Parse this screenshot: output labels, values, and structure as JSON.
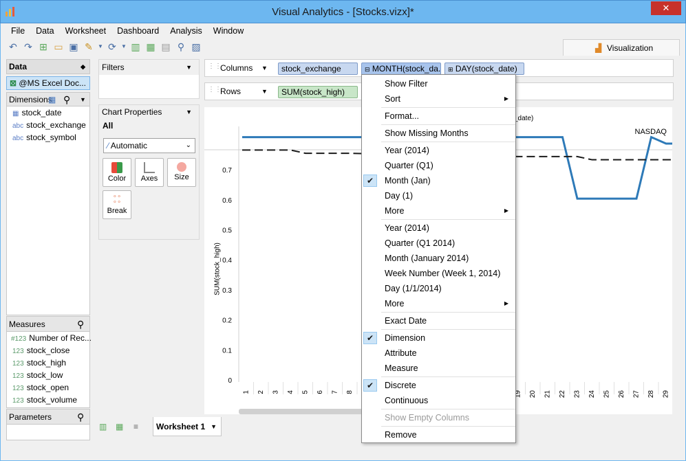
{
  "window": {
    "title": "Visual Analytics - [Stocks.vizx]*",
    "close": "✕"
  },
  "menu": [
    "File",
    "Data",
    "Worksheet",
    "Dashboard",
    "Analysis",
    "Window"
  ],
  "vis_tab": "Visualization",
  "data_panel": {
    "header": "Data",
    "source": "@MS Excel Doc...",
    "dimensions_header": "Dimensions",
    "dimensions": [
      {
        "type": "date",
        "name": "stock_date"
      },
      {
        "type": "abc",
        "name": "stock_exchange"
      },
      {
        "type": "abc",
        "name": "stock_symbol"
      }
    ],
    "measures_header": "Measures",
    "measures": [
      {
        "type": "#123",
        "name": "Number of Rec..."
      },
      {
        "type": "123",
        "name": "stock_close"
      },
      {
        "type": "123",
        "name": "stock_high"
      },
      {
        "type": "123",
        "name": "stock_low"
      },
      {
        "type": "123",
        "name": "stock_open"
      },
      {
        "type": "123",
        "name": "stock_volume"
      }
    ],
    "parameters_header": "Parameters"
  },
  "filters": {
    "header": "Filters"
  },
  "chart_properties": {
    "header": "Chart Properties",
    "all": "All",
    "mark_type": "Automatic",
    "buttons": [
      "Color",
      "Axes",
      "Size",
      "Break"
    ]
  },
  "shelves": {
    "columns_label": "Columns",
    "rows_label": "Rows",
    "columns": [
      "stock_exchange",
      "MONTH(stock_da...",
      "DAY(stock_date)"
    ],
    "rows": [
      "SUM(stock_high)"
    ]
  },
  "context_menu": [
    {
      "label": "Show Filter"
    },
    {
      "label": "Sort",
      "sub": true
    },
    {
      "sep": true
    },
    {
      "label": "Format..."
    },
    {
      "sep": true
    },
    {
      "label": "Show Missing Months"
    },
    {
      "sep": true
    },
    {
      "label": "Year (2014)"
    },
    {
      "label": "Quarter (Q1)"
    },
    {
      "label": "Month (Jan)",
      "checked": true
    },
    {
      "label": "Day (1)"
    },
    {
      "label": "More",
      "sub": true
    },
    {
      "sep": true
    },
    {
      "label": "Year (2014)"
    },
    {
      "label": "Quarter (Q1 2014)"
    },
    {
      "label": "Month (January 2014)"
    },
    {
      "label": "Week Number (Week 1, 2014)"
    },
    {
      "label": "Day (1/1/2014)"
    },
    {
      "label": "More",
      "sub": true
    },
    {
      "sep": true
    },
    {
      "label": "Exact Date"
    },
    {
      "sep": true
    },
    {
      "label": "Dimension",
      "checked": true
    },
    {
      "label": "Attribute"
    },
    {
      "label": "Measure"
    },
    {
      "sep": true
    },
    {
      "label": "Discrete",
      "checked": true
    },
    {
      "label": "Continuous"
    },
    {
      "sep": true
    },
    {
      "label": "Show Empty Columns",
      "disabled": true
    },
    {
      "sep": true
    },
    {
      "label": "Remove"
    }
  ],
  "worksheet_tab": "Worksheet 1",
  "chart_data": {
    "type": "line",
    "title": "",
    "header_right": "NASDAQ",
    "header_partial": "ck_date)",
    "ylabel": "SUM(stock_high)",
    "ylim": [
      0,
      0.8
    ],
    "yticks": [
      "0",
      "0.1",
      "0.2",
      "0.3",
      "0.4",
      "0.5",
      "0.6",
      "0.7"
    ],
    "x": [
      "1",
      "2",
      "3",
      "4",
      "5",
      "6",
      "7",
      "8",
      "19",
      "20",
      "21",
      "22",
      "23",
      "24",
      "25",
      "26",
      "27",
      "28",
      "29"
    ],
    "series": [
      {
        "values": [
          0.75,
          0.75,
          0.75,
          0.75,
          0.75,
          0.75,
          0.75,
          0.75,
          0.75,
          0.75,
          0.75,
          0.75,
          0.56,
          0.56,
          0.56,
          0.56,
          0.56,
          0.75,
          0.73
        ]
      },
      {
        "values": [
          0.71,
          0.71,
          0.71,
          0.71,
          0.7,
          0.7,
          0.7,
          0.7,
          0.69,
          0.69,
          0.69,
          0.69,
          0.69,
          0.68,
          0.68,
          0.68,
          0.68,
          0.68,
          0.68
        ],
        "style": "dashed"
      }
    ]
  }
}
